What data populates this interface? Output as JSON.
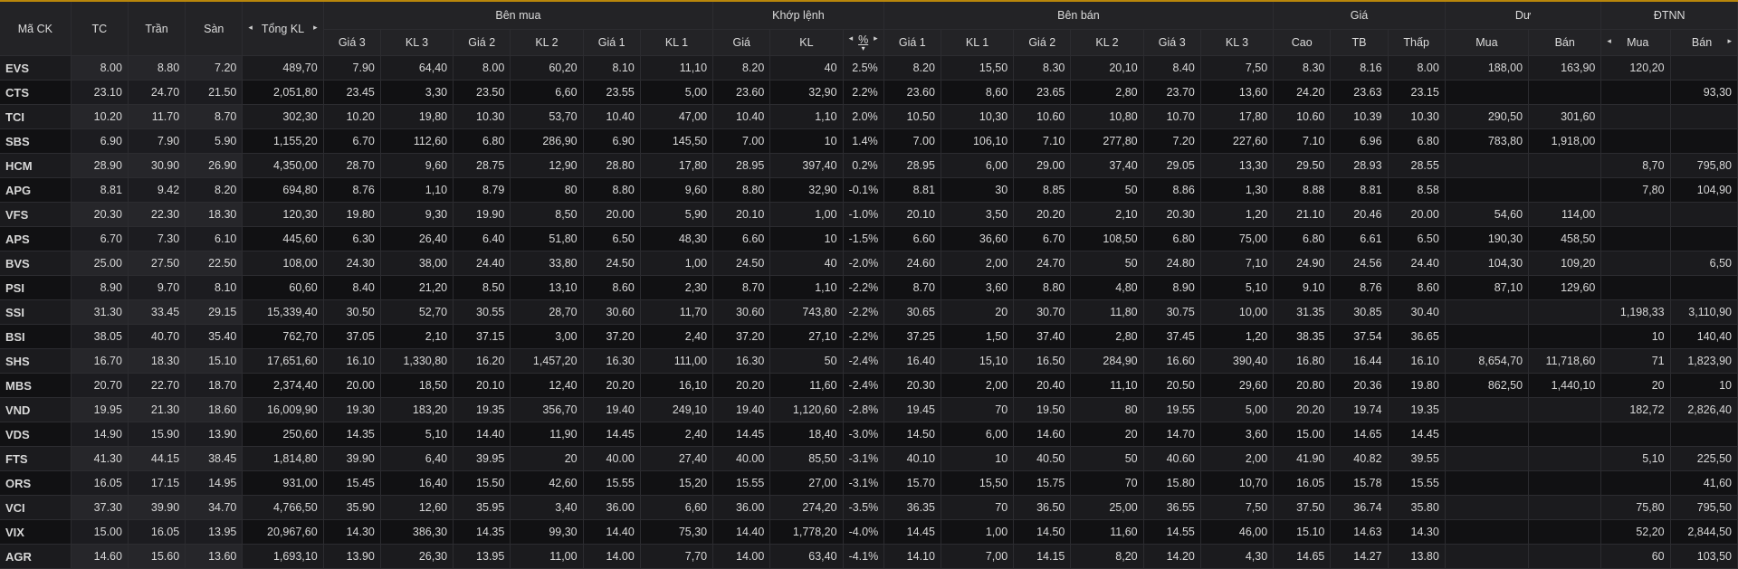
{
  "headers": {
    "symbol": "Mã CK",
    "ref": "TC",
    "ceil": "Trần",
    "floor": "Sàn",
    "total_vol": "Tổng KL",
    "buy_group": "Bên mua",
    "match_group": "Khớp lệnh",
    "sell_group": "Bên bán",
    "price_group": "Giá",
    "remain_group": "Dư",
    "foreign_group": "ĐTNN",
    "sub": [
      "Giá 3",
      "KL 3",
      "Giá 2",
      "KL 2",
      "Giá 1",
      "KL 1",
      "Giá",
      "KL",
      "%",
      "Giá 1",
      "KL 1",
      "Giá 2",
      "KL 2",
      "Giá 3",
      "KL 3",
      "Cao",
      "TB",
      "Thấp",
      "Mua",
      "Bán",
      "Mua",
      "Bán"
    ]
  },
  "icons": {
    "arrow_left": "◂",
    "arrow_right": "▸",
    "sort_up": "▴",
    "sort_down": "▾"
  },
  "colors": {
    "up": "#1fe31f",
    "down": "#ff3b3b",
    "ref": "#f5d34a",
    "ceil": "#e35cf5",
    "floor": "#5bd4f0",
    "header_accent": "#b8860b"
  },
  "rows": [
    {
      "s": "EVS",
      "tc": "8.00",
      "tr": "8.80",
      "sa": "7.20",
      "tkl": "489,70",
      "b3p": "7.90",
      "b3v": "64,40",
      "b2p": "8.00",
      "b2v": "60,20",
      "b1p": "8.10",
      "b1v": "11,10",
      "mp": "8.20",
      "mv": "40",
      "pct": "2.5%",
      "s1p": "8.20",
      "s1v": "15,50",
      "s2p": "8.30",
      "s2v": "20,10",
      "s3p": "8.40",
      "s3v": "7,50",
      "hi": "8.30",
      "avg": "8.16",
      "lo": "8.00",
      "rb": "188,00",
      "rs": "163,90",
      "fb": "120,20",
      "fs": ""
    },
    {
      "s": "CTS",
      "tc": "23.10",
      "tr": "24.70",
      "sa": "21.50",
      "tkl": "2,051,80",
      "b3p": "23.45",
      "b3v": "3,30",
      "b2p": "23.50",
      "b2v": "6,60",
      "b1p": "23.55",
      "b1v": "5,00",
      "mp": "23.60",
      "mv": "32,90",
      "pct": "2.2%",
      "s1p": "23.60",
      "s1v": "8,60",
      "s2p": "23.65",
      "s2v": "2,80",
      "s3p": "23.70",
      "s3v": "13,60",
      "hi": "24.20",
      "avg": "23.63",
      "lo": "23.15",
      "rb": "",
      "rs": "",
      "fb": "",
      "fs": "93,30"
    },
    {
      "s": "TCI",
      "tc": "10.20",
      "tr": "11.70",
      "sa": "8.70",
      "tkl": "302,30",
      "b3p": "10.20",
      "b3v": "19,80",
      "b2p": "10.30",
      "b2v": "53,70",
      "b1p": "10.40",
      "b1v": "47,00",
      "mp": "10.40",
      "mv": "1,10",
      "pct": "2.0%",
      "s1p": "10.50",
      "s1v": "10,30",
      "s2p": "10.60",
      "s2v": "10,80",
      "s3p": "10.70",
      "s3v": "17,80",
      "hi": "10.60",
      "avg": "10.39",
      "lo": "10.30",
      "rb": "290,50",
      "rs": "301,60",
      "fb": "",
      "fs": ""
    },
    {
      "s": "SBS",
      "tc": "6.90",
      "tr": "7.90",
      "sa": "5.90",
      "tkl": "1,155,20",
      "b3p": "6.70",
      "b3v": "112,60",
      "b2p": "6.80",
      "b2v": "286,90",
      "b1p": "6.90",
      "b1v": "145,50",
      "mp": "7.00",
      "mv": "10",
      "pct": "1.4%",
      "s1p": "7.00",
      "s1v": "106,10",
      "s2p": "7.10",
      "s2v": "277,80",
      "s3p": "7.20",
      "s3v": "227,60",
      "hi": "7.10",
      "avg": "6.96",
      "lo": "6.80",
      "rb": "783,80",
      "rs": "1,918,00",
      "fb": "",
      "fs": ""
    },
    {
      "s": "HCM",
      "tc": "28.90",
      "tr": "30.90",
      "sa": "26.90",
      "tkl": "4,350,00",
      "b3p": "28.70",
      "b3v": "9,60",
      "b2p": "28.75",
      "b2v": "12,90",
      "b1p": "28.80",
      "b1v": "17,80",
      "mp": "28.95",
      "mv": "397,40",
      "pct": "0.2%",
      "s1p": "28.95",
      "s1v": "6,00",
      "s2p": "29.00",
      "s2v": "37,40",
      "s3p": "29.05",
      "s3v": "13,30",
      "hi": "29.50",
      "avg": "28.93",
      "lo": "28.55",
      "rb": "",
      "rs": "",
      "fb": "8,70",
      "fs": "795,80"
    },
    {
      "s": "APG",
      "tc": "8.81",
      "tr": "9.42",
      "sa": "8.20",
      "tkl": "694,80",
      "b3p": "8.76",
      "b3v": "1,10",
      "b2p": "8.79",
      "b2v": "80",
      "b1p": "8.80",
      "b1v": "9,60",
      "mp": "8.80",
      "mv": "32,90",
      "pct": "-0.1%",
      "s1p": "8.81",
      "s1v": "30",
      "s2p": "8.85",
      "s2v": "50",
      "s3p": "8.86",
      "s3v": "1,30",
      "hi": "8.88",
      "avg": "8.81",
      "lo": "8.58",
      "rb": "",
      "rs": "",
      "fb": "7,80",
      "fs": "104,90"
    },
    {
      "s": "VFS",
      "tc": "20.30",
      "tr": "22.30",
      "sa": "18.30",
      "tkl": "120,30",
      "b3p": "19.80",
      "b3v": "9,30",
      "b2p": "19.90",
      "b2v": "8,50",
      "b1p": "20.00",
      "b1v": "5,90",
      "mp": "20.10",
      "mv": "1,00",
      "pct": "-1.0%",
      "s1p": "20.10",
      "s1v": "3,50",
      "s2p": "20.20",
      "s2v": "2,10",
      "s3p": "20.30",
      "s3v": "1,20",
      "hi": "21.10",
      "avg": "20.46",
      "lo": "20.00",
      "rb": "54,60",
      "rs": "114,00",
      "fb": "",
      "fs": ""
    },
    {
      "s": "APS",
      "tc": "6.70",
      "tr": "7.30",
      "sa": "6.10",
      "tkl": "445,60",
      "b3p": "6.30",
      "b3v": "26,40",
      "b2p": "6.40",
      "b2v": "51,80",
      "b1p": "6.50",
      "b1v": "48,30",
      "mp": "6.60",
      "mv": "10",
      "pct": "-1.5%",
      "s1p": "6.60",
      "s1v": "36,60",
      "s2p": "6.70",
      "s2v": "108,50",
      "s3p": "6.80",
      "s3v": "75,00",
      "hi": "6.80",
      "avg": "6.61",
      "lo": "6.50",
      "rb": "190,30",
      "rs": "458,50",
      "fb": "",
      "fs": ""
    },
    {
      "s": "BVS",
      "tc": "25.00",
      "tr": "27.50",
      "sa": "22.50",
      "tkl": "108,00",
      "b3p": "24.30",
      "b3v": "38,00",
      "b2p": "24.40",
      "b2v": "33,80",
      "b1p": "24.50",
      "b1v": "1,00",
      "mp": "24.50",
      "mv": "40",
      "pct": "-2.0%",
      "s1p": "24.60",
      "s1v": "2,00",
      "s2p": "24.70",
      "s2v": "50",
      "s3p": "24.80",
      "s3v": "7,10",
      "hi": "24.90",
      "avg": "24.56",
      "lo": "24.40",
      "rb": "104,30",
      "rs": "109,20",
      "fb": "",
      "fs": "6,50"
    },
    {
      "s": "PSI",
      "tc": "8.90",
      "tr": "9.70",
      "sa": "8.10",
      "tkl": "60,60",
      "b3p": "8.40",
      "b3v": "21,20",
      "b2p": "8.50",
      "b2v": "13,10",
      "b1p": "8.60",
      "b1v": "2,30",
      "mp": "8.70",
      "mv": "1,10",
      "pct": "-2.2%",
      "s1p": "8.70",
      "s1v": "3,60",
      "s2p": "8.80",
      "s2v": "4,80",
      "s3p": "8.90",
      "s3v": "5,10",
      "hi": "9.10",
      "avg": "8.76",
      "lo": "8.60",
      "rb": "87,10",
      "rs": "129,60",
      "fb": "",
      "fs": ""
    },
    {
      "s": "SSI",
      "tc": "31.30",
      "tr": "33.45",
      "sa": "29.15",
      "tkl": "15,339,40",
      "b3p": "30.50",
      "b3v": "52,70",
      "b2p": "30.55",
      "b2v": "28,70",
      "b1p": "30.60",
      "b1v": "11,70",
      "mp": "30.60",
      "mv": "743,80",
      "pct": "-2.2%",
      "s1p": "30.65",
      "s1v": "20",
      "s2p": "30.70",
      "s2v": "11,80",
      "s3p": "30.75",
      "s3v": "10,00",
      "hi": "31.35",
      "avg": "30.85",
      "lo": "30.40",
      "rb": "",
      "rs": "",
      "fb": "1,198,33",
      "fs": "3,110,90"
    },
    {
      "s": "BSI",
      "tc": "38.05",
      "tr": "40.70",
      "sa": "35.40",
      "tkl": "762,70",
      "b3p": "37.05",
      "b3v": "2,10",
      "b2p": "37.15",
      "b2v": "3,00",
      "b1p": "37.20",
      "b1v": "2,40",
      "mp": "37.20",
      "mv": "27,10",
      "pct": "-2.2%",
      "s1p": "37.25",
      "s1v": "1,50",
      "s2p": "37.40",
      "s2v": "2,80",
      "s3p": "37.45",
      "s3v": "1,20",
      "hi": "38.35",
      "avg": "37.54",
      "lo": "36.65",
      "rb": "",
      "rs": "",
      "fb": "10",
      "fs": "140,40"
    },
    {
      "s": "SHS",
      "tc": "16.70",
      "tr": "18.30",
      "sa": "15.10",
      "tkl": "17,651,60",
      "b3p": "16.10",
      "b3v": "1,330,80",
      "b2p": "16.20",
      "b2v": "1,457,20",
      "b1p": "16.30",
      "b1v": "111,00",
      "mp": "16.30",
      "mv": "50",
      "pct": "-2.4%",
      "s1p": "16.40",
      "s1v": "15,10",
      "s2p": "16.50",
      "s2v": "284,90",
      "s3p": "16.60",
      "s3v": "390,40",
      "hi": "16.80",
      "avg": "16.44",
      "lo": "16.10",
      "rb": "8,654,70",
      "rs": "11,718,60",
      "fb": "71",
      "fs": "1,823,90"
    },
    {
      "s": "MBS",
      "tc": "20.70",
      "tr": "22.70",
      "sa": "18.70",
      "tkl": "2,374,40",
      "b3p": "20.00",
      "b3v": "18,50",
      "b2p": "20.10",
      "b2v": "12,40",
      "b1p": "20.20",
      "b1v": "16,10",
      "mp": "20.20",
      "mv": "11,60",
      "pct": "-2.4%",
      "s1p": "20.30",
      "s1v": "2,00",
      "s2p": "20.40",
      "s2v": "11,10",
      "s3p": "20.50",
      "s3v": "29,60",
      "hi": "20.80",
      "avg": "20.36",
      "lo": "19.80",
      "rb": "862,50",
      "rs": "1,440,10",
      "fb": "20",
      "fs": "10"
    },
    {
      "s": "VND",
      "tc": "19.95",
      "tr": "21.30",
      "sa": "18.60",
      "tkl": "16,009,90",
      "b3p": "19.30",
      "b3v": "183,20",
      "b2p": "19.35",
      "b2v": "356,70",
      "b1p": "19.40",
      "b1v": "249,10",
      "mp": "19.40",
      "mv": "1,120,60",
      "pct": "-2.8%",
      "s1p": "19.45",
      "s1v": "70",
      "s2p": "19.50",
      "s2v": "80",
      "s3p": "19.55",
      "s3v": "5,00",
      "hi": "20.20",
      "avg": "19.74",
      "lo": "19.35",
      "rb": "",
      "rs": "",
      "fb": "182,72",
      "fs": "2,826,40"
    },
    {
      "s": "VDS",
      "tc": "14.90",
      "tr": "15.90",
      "sa": "13.90",
      "tkl": "250,60",
      "b3p": "14.35",
      "b3v": "5,10",
      "b2p": "14.40",
      "b2v": "11,90",
      "b1p": "14.45",
      "b1v": "2,40",
      "mp": "14.45",
      "mv": "18,40",
      "pct": "-3.0%",
      "s1p": "14.50",
      "s1v": "6,00",
      "s2p": "14.60",
      "s2v": "20",
      "s3p": "14.70",
      "s3v": "3,60",
      "hi": "15.00",
      "avg": "14.65",
      "lo": "14.45",
      "rb": "",
      "rs": "",
      "fb": "",
      "fs": ""
    },
    {
      "s": "FTS",
      "tc": "41.30",
      "tr": "44.15",
      "sa": "38.45",
      "tkl": "1,814,80",
      "b3p": "39.90",
      "b3v": "6,40",
      "b2p": "39.95",
      "b2v": "20",
      "b1p": "40.00",
      "b1v": "27,40",
      "mp": "40.00",
      "mv": "85,50",
      "pct": "-3.1%",
      "s1p": "40.10",
      "s1v": "10",
      "s2p": "40.50",
      "s2v": "50",
      "s3p": "40.60",
      "s3v": "2,00",
      "hi": "41.90",
      "avg": "40.82",
      "lo": "39.55",
      "rb": "",
      "rs": "",
      "fb": "5,10",
      "fs": "225,50"
    },
    {
      "s": "ORS",
      "tc": "16.05",
      "tr": "17.15",
      "sa": "14.95",
      "tkl": "931,00",
      "b3p": "15.45",
      "b3v": "16,40",
      "b2p": "15.50",
      "b2v": "42,60",
      "b1p": "15.55",
      "b1v": "15,20",
      "mp": "15.55",
      "mv": "27,00",
      "pct": "-3.1%",
      "s1p": "15.70",
      "s1v": "15,50",
      "s2p": "15.75",
      "s2v": "70",
      "s3p": "15.80",
      "s3v": "10,70",
      "hi": "16.05",
      "avg": "15.78",
      "lo": "15.55",
      "rb": "",
      "rs": "",
      "fb": "",
      "fs": "41,60"
    },
    {
      "s": "VCI",
      "tc": "37.30",
      "tr": "39.90",
      "sa": "34.70",
      "tkl": "4,766,50",
      "b3p": "35.90",
      "b3v": "12,60",
      "b2p": "35.95",
      "b2v": "3,40",
      "b1p": "36.00",
      "b1v": "6,60",
      "mp": "36.00",
      "mv": "274,20",
      "pct": "-3.5%",
      "s1p": "36.35",
      "s1v": "70",
      "s2p": "36.50",
      "s2v": "25,00",
      "s3p": "36.55",
      "s3v": "7,50",
      "hi": "37.50",
      "avg": "36.74",
      "lo": "35.80",
      "rb": "",
      "rs": "",
      "fb": "75,80",
      "fs": "795,50"
    },
    {
      "s": "VIX",
      "tc": "15.00",
      "tr": "16.05",
      "sa": "13.95",
      "tkl": "20,967,60",
      "b3p": "14.30",
      "b3v": "386,30",
      "b2p": "14.35",
      "b2v": "99,30",
      "b1p": "14.40",
      "b1v": "75,30",
      "mp": "14.40",
      "mv": "1,778,20",
      "pct": "-4.0%",
      "s1p": "14.45",
      "s1v": "1,00",
      "s2p": "14.50",
      "s2v": "11,60",
      "s3p": "14.55",
      "s3v": "46,00",
      "hi": "15.10",
      "avg": "14.63",
      "lo": "14.30",
      "rb": "",
      "rs": "",
      "fb": "52,20",
      "fs": "2,844,50"
    },
    {
      "s": "AGR",
      "tc": "14.60",
      "tr": "15.60",
      "sa": "13.60",
      "tkl": "1,693,10",
      "b3p": "13.90",
      "b3v": "26,30",
      "b2p": "13.95",
      "b2v": "11,00",
      "b1p": "14.00",
      "b1v": "7,70",
      "mp": "14.00",
      "mv": "63,40",
      "pct": "-4.1%",
      "s1p": "14.10",
      "s1v": "7,00",
      "s2p": "14.15",
      "s2v": "8,20",
      "s3p": "14.20",
      "s3v": "4,30",
      "hi": "14.65",
      "avg": "14.27",
      "lo": "13.80",
      "rb": "",
      "rs": "",
      "fb": "60",
      "fs": "103,50"
    }
  ]
}
